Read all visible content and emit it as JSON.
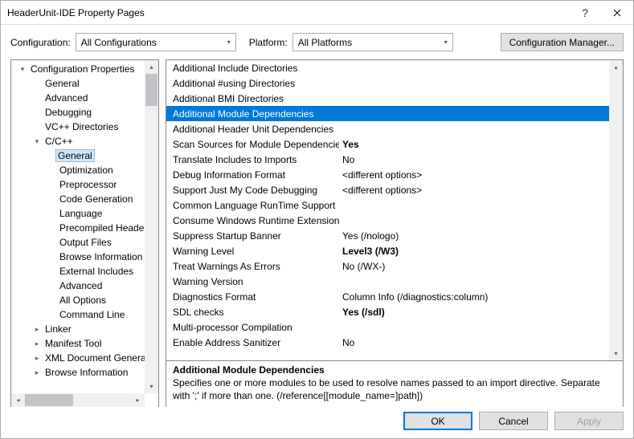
{
  "window": {
    "title": "HeaderUnit-IDE Property Pages"
  },
  "toolbar": {
    "config_label": "Configuration:",
    "config_value": "All Configurations",
    "platform_label": "Platform:",
    "platform_value": "All Platforms",
    "cfgmgr_label": "Configuration Manager..."
  },
  "tree": [
    {
      "label": "Configuration Properties",
      "depth": 0,
      "caret": "▾"
    },
    {
      "label": "General",
      "depth": 1,
      "caret": ""
    },
    {
      "label": "Advanced",
      "depth": 1,
      "caret": ""
    },
    {
      "label": "Debugging",
      "depth": 1,
      "caret": ""
    },
    {
      "label": "VC++ Directories",
      "depth": 1,
      "caret": ""
    },
    {
      "label": "C/C++",
      "depth": 1,
      "caret": "▾"
    },
    {
      "label": "General",
      "depth": 2,
      "caret": "",
      "selected": true
    },
    {
      "label": "Optimization",
      "depth": 2,
      "caret": ""
    },
    {
      "label": "Preprocessor",
      "depth": 2,
      "caret": ""
    },
    {
      "label": "Code Generation",
      "depth": 2,
      "caret": ""
    },
    {
      "label": "Language",
      "depth": 2,
      "caret": ""
    },
    {
      "label": "Precompiled Heade",
      "depth": 2,
      "caret": ""
    },
    {
      "label": "Output Files",
      "depth": 2,
      "caret": ""
    },
    {
      "label": "Browse Information",
      "depth": 2,
      "caret": ""
    },
    {
      "label": "External Includes",
      "depth": 2,
      "caret": ""
    },
    {
      "label": "Advanced",
      "depth": 2,
      "caret": ""
    },
    {
      "label": "All Options",
      "depth": 2,
      "caret": ""
    },
    {
      "label": "Command Line",
      "depth": 2,
      "caret": ""
    },
    {
      "label": "Linker",
      "depth": 1,
      "caret": "▸"
    },
    {
      "label": "Manifest Tool",
      "depth": 1,
      "caret": "▸"
    },
    {
      "label": "XML Document Genera",
      "depth": 1,
      "caret": "▸"
    },
    {
      "label": "Browse Information",
      "depth": 1,
      "caret": "▸"
    }
  ],
  "props": [
    {
      "name": "Additional Include Directories",
      "value": ""
    },
    {
      "name": "Additional #using Directories",
      "value": ""
    },
    {
      "name": "Additional BMI Directories",
      "value": ""
    },
    {
      "name": "Additional Module Dependencies",
      "value": "",
      "selected": true
    },
    {
      "name": "Additional Header Unit Dependencies",
      "value": ""
    },
    {
      "name": "Scan Sources for Module Dependencies",
      "value": "Yes",
      "bold": true
    },
    {
      "name": "Translate Includes to Imports",
      "value": "No"
    },
    {
      "name": "Debug Information Format",
      "value": "<different options>"
    },
    {
      "name": "Support Just My Code Debugging",
      "value": "<different options>"
    },
    {
      "name": "Common Language RunTime Support",
      "value": ""
    },
    {
      "name": "Consume Windows Runtime Extension",
      "value": ""
    },
    {
      "name": "Suppress Startup Banner",
      "value": "Yes (/nologo)"
    },
    {
      "name": "Warning Level",
      "value": "Level3 (/W3)",
      "bold": true
    },
    {
      "name": "Treat Warnings As Errors",
      "value": "No (/WX-)"
    },
    {
      "name": "Warning Version",
      "value": ""
    },
    {
      "name": "Diagnostics Format",
      "value": "Column Info (/diagnostics:column)"
    },
    {
      "name": "SDL checks",
      "value": "Yes (/sdl)",
      "bold": true
    },
    {
      "name": "Multi-processor Compilation",
      "value": ""
    },
    {
      "name": "Enable Address Sanitizer",
      "value": "No"
    }
  ],
  "desc": {
    "heading": "Additional Module Dependencies",
    "text": "Specifies one or more modules to be used to resolve names passed to an import directive. Separate with ';' if more than one.  (/reference[[module_name=]path])"
  },
  "footer": {
    "ok": "OK",
    "cancel": "Cancel",
    "apply": "Apply"
  }
}
